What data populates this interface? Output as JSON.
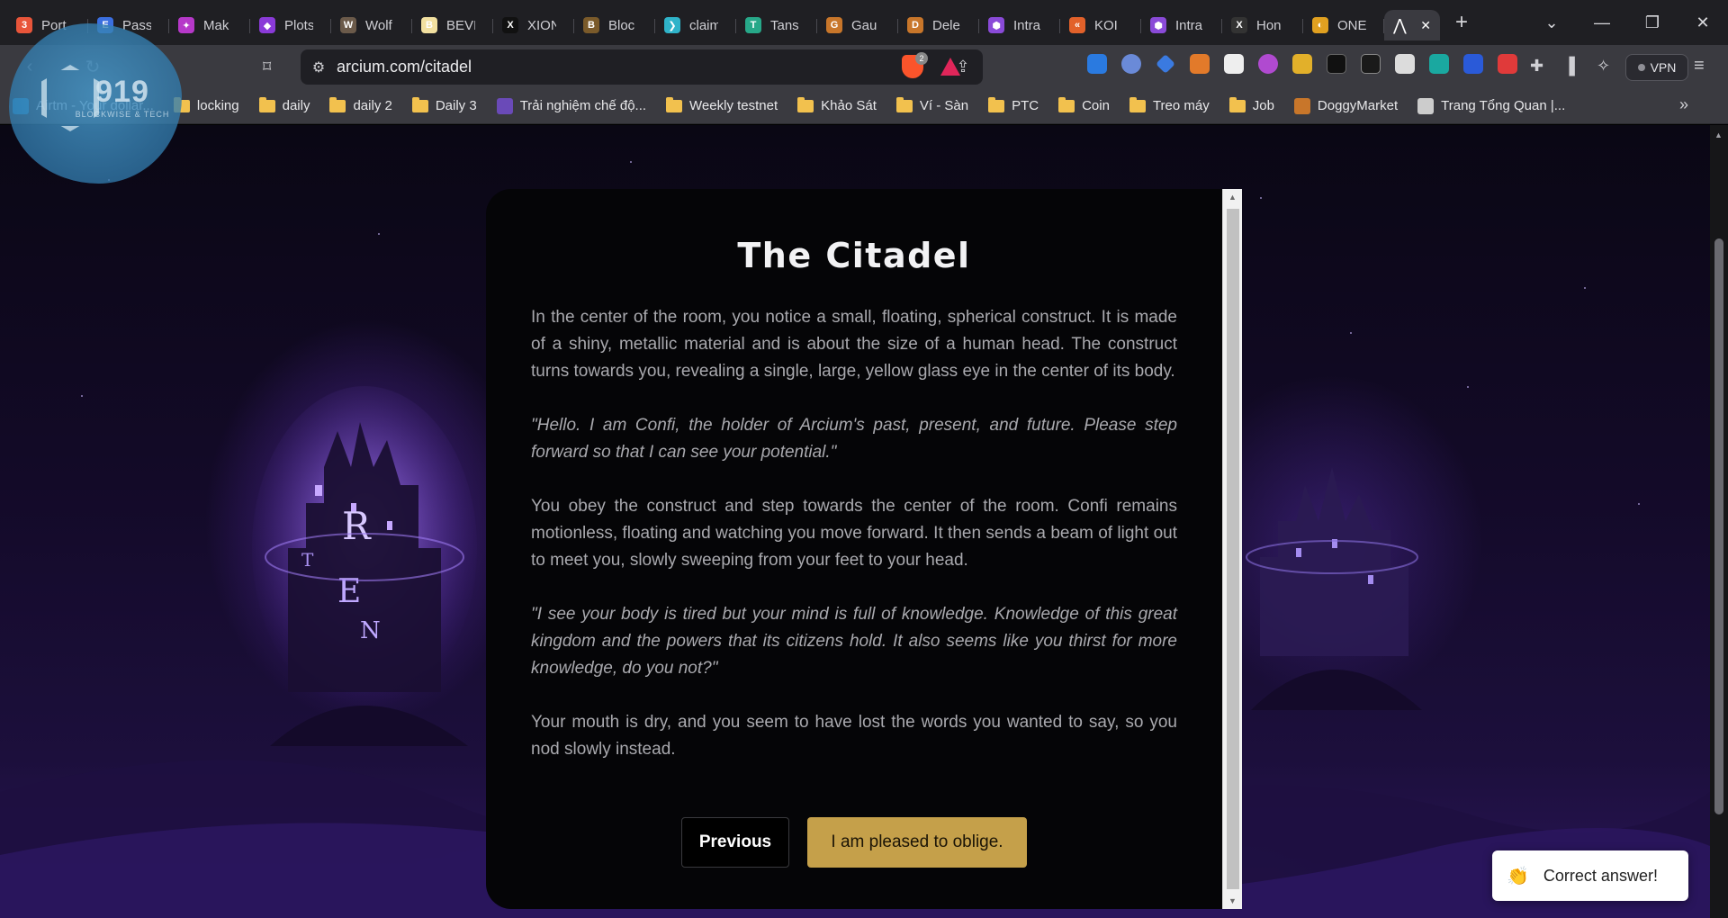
{
  "browser": {
    "tabs": [
      {
        "title": "Port",
        "color": "#e8553a",
        "glyph": "3"
      },
      {
        "title": "Pass",
        "color": "#3b6fe0",
        "glyph": "E"
      },
      {
        "title": "Mak",
        "color": "#b638c9",
        "glyph": "✦"
      },
      {
        "title": "Plots",
        "color": "#8a3ad8",
        "glyph": "◆"
      },
      {
        "title": "Wolf",
        "color": "#6b5a4a",
        "glyph": "W"
      },
      {
        "title": "BEVI",
        "color": "#f2e0a0",
        "glyph": "B"
      },
      {
        "title": "XION",
        "color": "#111111",
        "glyph": "X"
      },
      {
        "title": "Bloc",
        "color": "#7a5a2a",
        "glyph": "B"
      },
      {
        "title": "claim",
        "color": "#2fb3c9",
        "glyph": "❯"
      },
      {
        "title": "Tans",
        "color": "#27a889",
        "glyph": "T"
      },
      {
        "title": "Gau",
        "color": "#c8762a",
        "glyph": "G"
      },
      {
        "title": "Dele",
        "color": "#c8762a",
        "glyph": "D"
      },
      {
        "title": "Intra",
        "color": "#8a4ad8",
        "glyph": "⬢"
      },
      {
        "title": "KOI",
        "color": "#e2612a",
        "glyph": "«"
      },
      {
        "title": "Intra",
        "color": "#8a4ad8",
        "glyph": "⬢"
      },
      {
        "title": "Hon",
        "color": "#333333",
        "glyph": "X"
      },
      {
        "title": "ONE",
        "color": "#e0a020",
        "glyph": "◐"
      }
    ],
    "active_tab_icon": "arcium-icon",
    "new_tab_label": "+",
    "url": "arcium.com/citadel",
    "brave_badge": "2",
    "vpn_label": "VPN"
  },
  "bookmarks": [
    {
      "label": "Airtm - Your dollar...",
      "type": "site",
      "color": "#2a9ad8"
    },
    {
      "label": "locking",
      "type": "folder"
    },
    {
      "label": "daily",
      "type": "folder"
    },
    {
      "label": "daily 2",
      "type": "folder"
    },
    {
      "label": "Daily 3",
      "type": "folder"
    },
    {
      "label": "Trải nghiệm chế độ...",
      "type": "site",
      "color": "#6a4ab8"
    },
    {
      "label": "Weekly testnet",
      "type": "folder"
    },
    {
      "label": "Khảo Sát",
      "type": "folder"
    },
    {
      "label": "Ví - Sàn",
      "type": "folder"
    },
    {
      "label": "PTC",
      "type": "folder"
    },
    {
      "label": "Coin",
      "type": "folder"
    },
    {
      "label": "Treo máy",
      "type": "folder"
    },
    {
      "label": "Job",
      "type": "folder"
    },
    {
      "label": "DoggyMarket",
      "type": "site",
      "color": "#c8762a"
    },
    {
      "label": "Trang Tổng Quan |...",
      "type": "site",
      "color": "#cccccc"
    }
  ],
  "watermark": {
    "number": "919",
    "subtitle": "BLOCKWISE & TECH"
  },
  "story": {
    "title": "The Citadel",
    "paragraphs": [
      {
        "text": "In the center of the room, you notice a small, floating, spherical construct. It is made of a shiny, metallic material and is about the size of a human head. The construct turns towards you, revealing a single, large, yellow glass eye in the center of its body.",
        "quote": false
      },
      {
        "text": "\"Hello. I am Confi, the holder of Arcium's past, present, and future. Please step forward so that I can see your potential.\"",
        "quote": true
      },
      {
        "text": "You obey the construct and step towards the center of the room. Confi remains motionless, floating and watching you move forward. It then sends a beam of light out to meet you, slowly sweeping from your feet to your head.",
        "quote": false
      },
      {
        "text": "\"I see your body is tired but your mind is full of knowledge. Knowledge of this great kingdom and the powers that its citizens hold. It also seems like you thirst for more knowledge, do you not?\"",
        "quote": true
      },
      {
        "text": "Your mouth is dry, and you seem to have lost the words you wanted to say, so you nod slowly instead.",
        "quote": false
      }
    ],
    "previous_label": "Previous",
    "next_label": "I am pleased to oblige."
  },
  "toast": {
    "message": "Correct answer!"
  },
  "colors": {
    "accent_gold": "#c5a04a",
    "card_bg": "#050507",
    "text_muted": "#a9a9ae"
  }
}
